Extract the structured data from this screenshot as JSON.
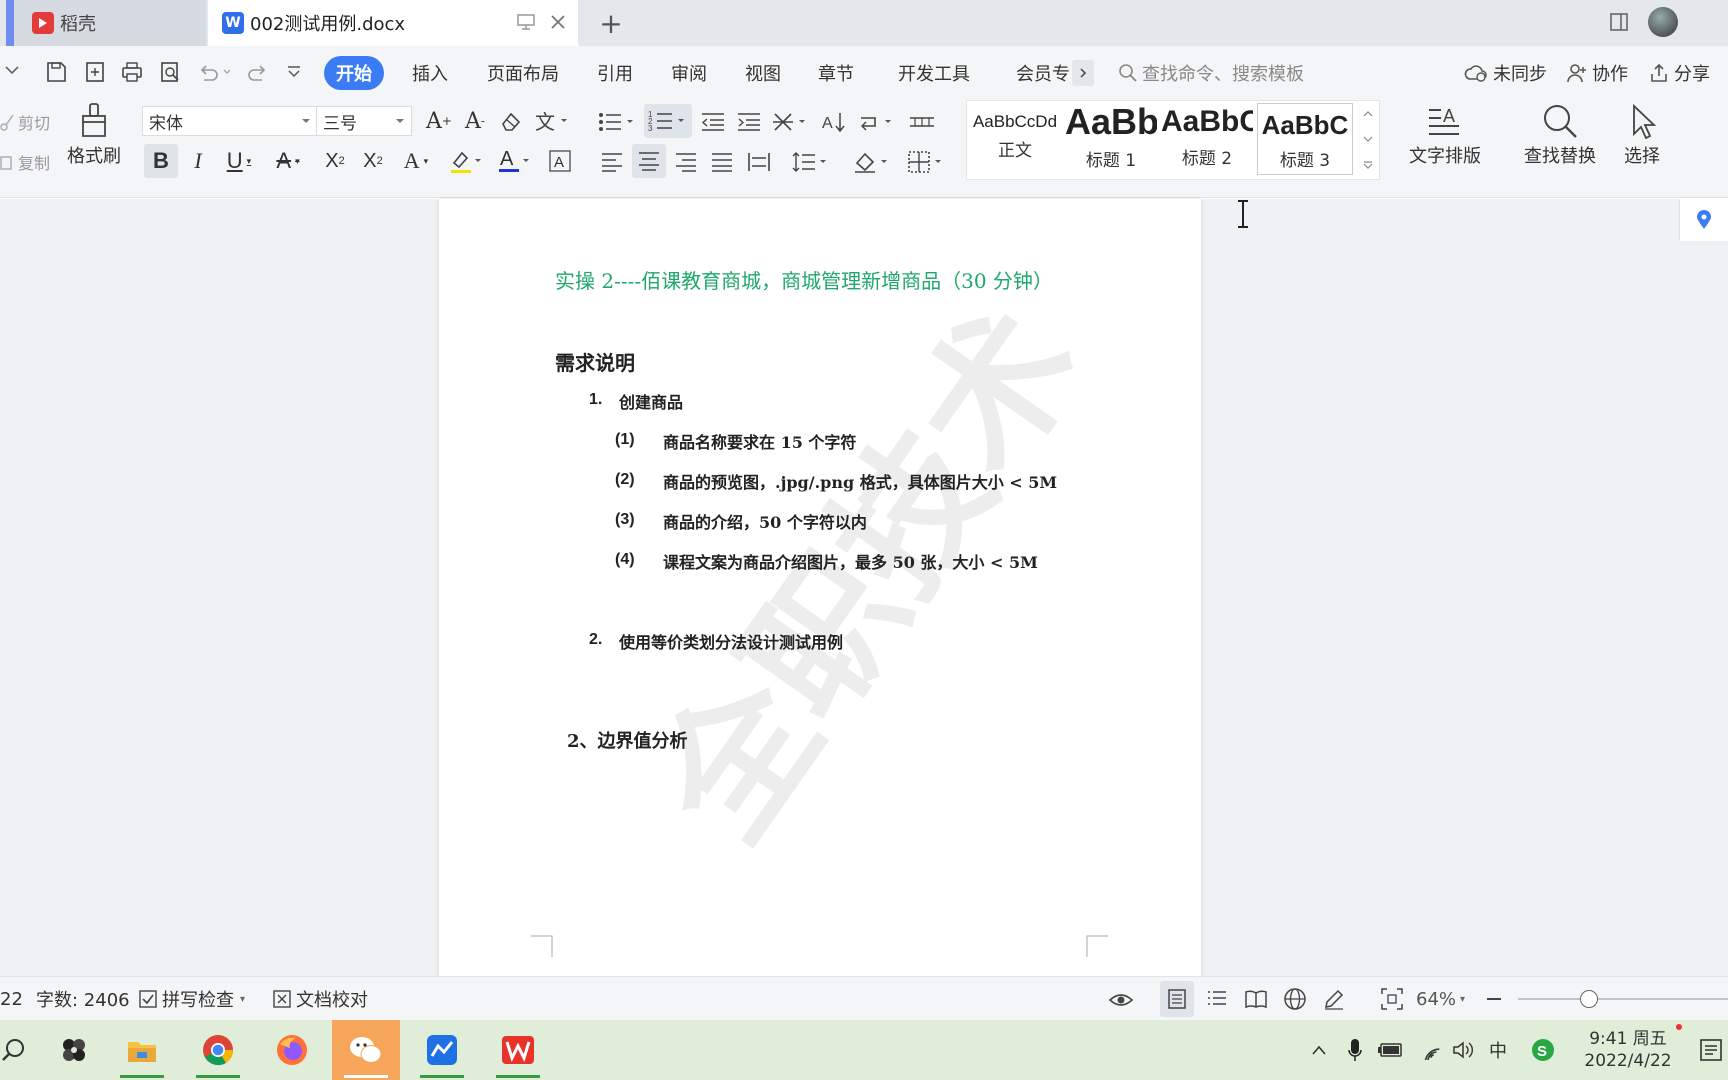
{
  "tabs": {
    "home_label": "稻壳",
    "doc_label": "002测试用例.docx"
  },
  "menu": {
    "items": [
      "开始",
      "插入",
      "页面布局",
      "引用",
      "审阅",
      "视图",
      "章节",
      "开发工具",
      "会员专"
    ],
    "search_placeholder": "查找命令、搜索模板",
    "sync_label": "未同步",
    "collab_label": "协作",
    "share_label": "分享"
  },
  "ribbon": {
    "cut_label": "剪切",
    "copy_label": "复制",
    "format_painter_label": "格式刷",
    "font_name": "宋体",
    "font_size": "三号",
    "styles": [
      {
        "sample": "AaBbCcDd",
        "label": "正文"
      },
      {
        "sample": "AaBb",
        "label": "标题 1"
      },
      {
        "sample": "AaBbC",
        "label": "标题 2"
      },
      {
        "sample": "AaBbC",
        "label": "标题 3"
      }
    ],
    "text_layout_label": "文字排版",
    "find_replace_label": "查找替换",
    "select_label": "选择"
  },
  "document": {
    "heading": "实操 2----佰课教育商城，商城管理新增商品（30 分钟）",
    "section_title": "需求说明",
    "item1_num": "1.",
    "item1_text": "创建商品",
    "sub_items": [
      {
        "num": "(1)",
        "text": "商品名称要求在 15 个字符"
      },
      {
        "num": "(2)",
        "text": "商品的预览图，.jpg/.png 格式，具体图片大小 < 5M"
      },
      {
        "num": "(3)",
        "text": "商品的介绍，50 个字符以内"
      },
      {
        "num": "(4)",
        "text": "课程文案为商品介绍图片，最多 50 张，大小 < 5M"
      }
    ],
    "item2_num": "2.",
    "item2_text": "使用等价类划分法设计测试用例",
    "section2_title": "2、边界值分析",
    "watermark": "全职技术"
  },
  "status": {
    "page_fragment": "22",
    "word_count": "字数: 2406",
    "spell_check": "拼写检查",
    "proofread": "文档校对",
    "zoom": "64%"
  },
  "taskbar": {
    "time": "9:41 周五",
    "date": "2022/4/22",
    "ime": "中"
  },
  "colors": {
    "accent": "#3b7cf5",
    "heading_green": "#1ea86a",
    "taskbar_bg": "#dfedd9"
  }
}
